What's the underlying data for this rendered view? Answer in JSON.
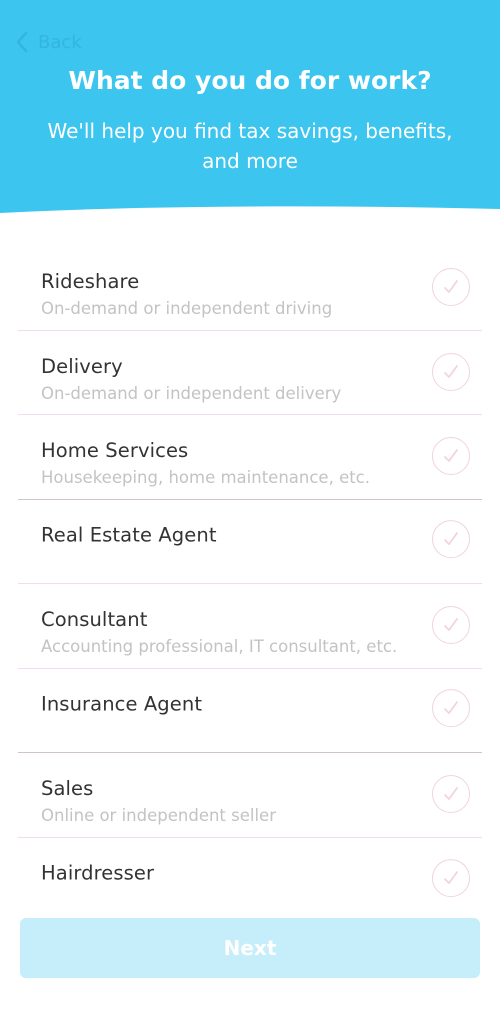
{
  "header": {
    "back_label": "Back",
    "title": "What do you do for work?",
    "subtitle": "We'll help you find tax savings, benefits, and more",
    "background_color": "#3cc5ee"
  },
  "work_options": [
    {
      "label": "Rideshare",
      "description": "On-demand or independent driving",
      "selected": false
    },
    {
      "label": "Delivery",
      "description": "On-demand or independent delivery",
      "selected": false
    },
    {
      "label": "Home Services",
      "description": "Housekeeping, home maintenance, etc.",
      "selected": false
    },
    {
      "label": "Real Estate Agent",
      "description": "",
      "selected": false
    },
    {
      "label": "Consultant",
      "description": "Accounting professional, IT consultant, etc.",
      "selected": false
    },
    {
      "label": "Insurance Agent",
      "description": "",
      "selected": false
    },
    {
      "label": "Sales",
      "description": "Online or independent seller",
      "selected": false
    },
    {
      "label": "Hairdresser",
      "description": "",
      "selected": false
    }
  ],
  "check_icon": "checkmark-circle-icon",
  "next_button": {
    "label": "Next",
    "enabled": false,
    "color": "#c6eefa"
  }
}
